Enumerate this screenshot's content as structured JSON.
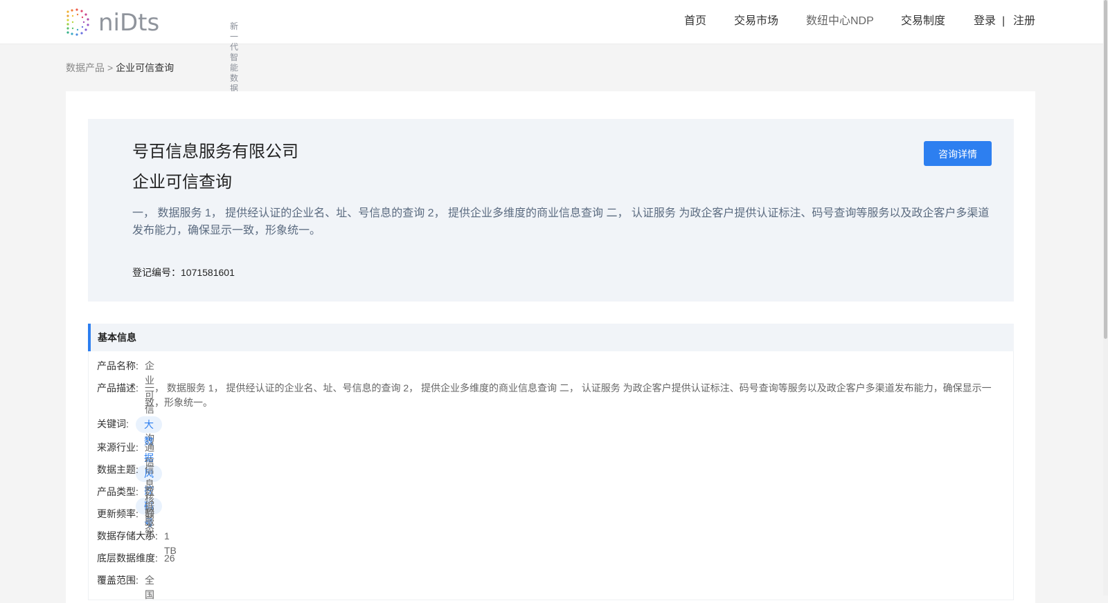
{
  "header": {
    "logo_text": "niDts",
    "logo_sub_line1": "新一代",
    "logo_sub_line2": "智能数据交易系统",
    "nav": {
      "home": "首页",
      "market": "交易市场",
      "ndp": "数纽中心NDP",
      "rules": "交易制度",
      "login": "登录",
      "separator": "|",
      "register": "注册"
    }
  },
  "breadcrumb": {
    "parent": "数据产品",
    "separator": ">",
    "current": "企业可信查询"
  },
  "hero": {
    "company": "号百信息服务有限公司",
    "title": "企业可信查询",
    "description": "一， 数据服务 1， 提供经认证的企业名、址、号信息的查询 2， 提供企业多维度的商业信息查询 二， 认证服务 为政企客户提供认证标注、码号查询等服务以及政企客户多渠道发布能力，确保显示一致，形象统一。",
    "registration": "登记编号：1071581601",
    "consult_button": "咨询详情"
  },
  "section": {
    "title": "基本信息"
  },
  "info": {
    "name_label": "产品名称:",
    "name_value": "企业可信查询",
    "desc_label": "产品描述:",
    "desc_value": "一， 数据服务 1， 提供经认证的企业名、址、号信息的查询 2， 提供企业多维度的商业信息查询 二， 认证服务 为政企客户提供认证标注、码号查询等服务以及政企客户多渠道发布能力，确保显示一致，形象统一。",
    "keywords_label": "关键词:",
    "keywords": [
      "大数据",
      "风控",
      "码号"
    ],
    "industry_label": "来源行业:",
    "industry_value": "通信",
    "theme_label": "数据主题:",
    "theme_value": "信息核验",
    "type_label": "产品类型:",
    "type_value": "数据服务",
    "freq_label": "更新频率:",
    "freq_value": "静态",
    "storage_label": "数据存储大小:",
    "storage_value": "1 TB",
    "dims_label": "底层数据维度:",
    "dims_value": "26",
    "coverage_label": "覆盖范围:",
    "coverage_value": "全国"
  },
  "colors": {
    "accent": "#2d7ff0",
    "hero_bg": "#f1f4f8",
    "page_bg": "#f4f4f4"
  }
}
